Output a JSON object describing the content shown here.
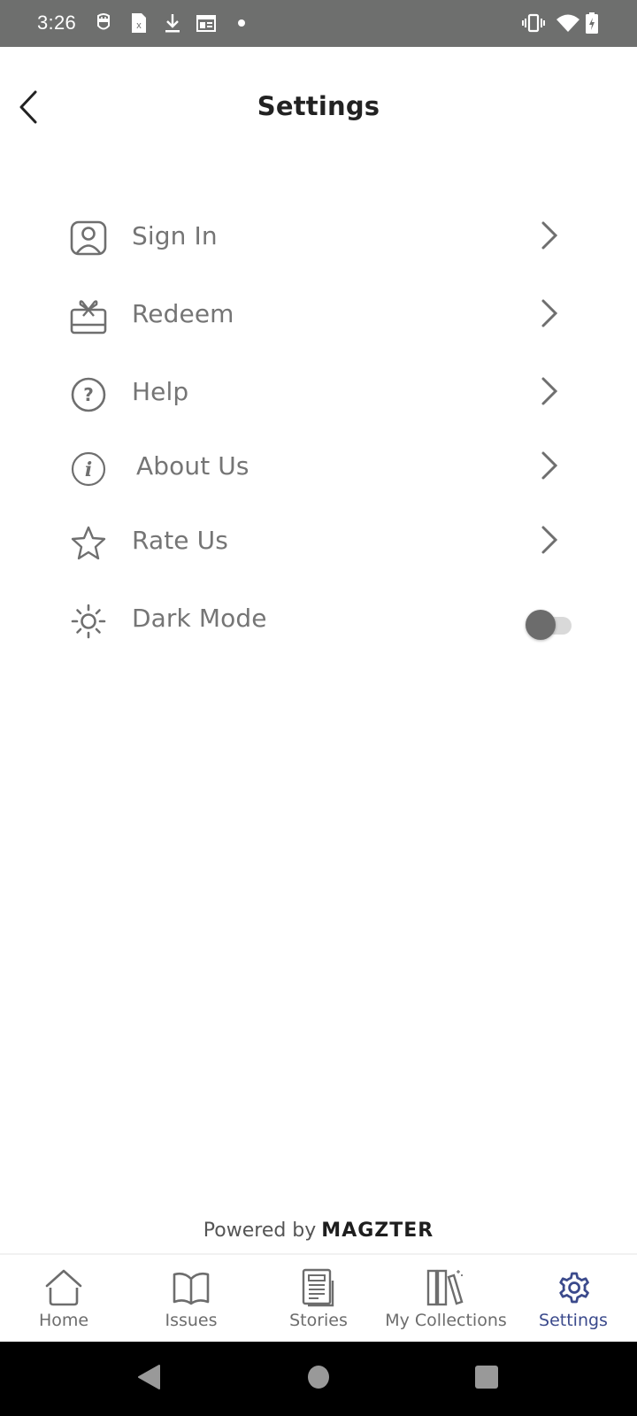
{
  "status_bar": {
    "time": "3:26",
    "left_icons": [
      "messaging-icon",
      "sim-card-icon",
      "download-icon",
      "calendar-icon",
      "notification-dot-icon"
    ],
    "right_icons": [
      "vibrate-icon",
      "wifi-icon",
      "battery-charging-icon"
    ]
  },
  "header": {
    "title": "Settings",
    "back_icon": "chevron-left-icon"
  },
  "menu": {
    "items": [
      {
        "label": "Sign In",
        "icon": "user-icon",
        "action": "chevron-right-icon"
      },
      {
        "label": "Redeem",
        "icon": "gift-icon",
        "action": "chevron-right-icon"
      },
      {
        "label": "Help",
        "icon": "help-circle-icon",
        "action": "chevron-right-icon"
      },
      {
        "label": "About Us",
        "icon": "info-icon",
        "action": "chevron-right-icon"
      },
      {
        "label": "Rate Us",
        "icon": "star-icon",
        "action": "chevron-right-icon"
      },
      {
        "label": "Dark Mode",
        "icon": "sun-icon",
        "action": "toggle",
        "toggle_on": false
      }
    ]
  },
  "footer": {
    "powered_by": "Powered by",
    "brand": "MAGZTER"
  },
  "bottom_nav": {
    "items": [
      {
        "label": "Home",
        "icon": "home-icon",
        "active": false
      },
      {
        "label": "Issues",
        "icon": "book-icon",
        "active": false
      },
      {
        "label": "Stories",
        "icon": "article-icon",
        "active": false
      },
      {
        "label": "My Collections",
        "icon": "collections-icon",
        "active": false
      },
      {
        "label": "Settings",
        "icon": "gear-icon",
        "active": true
      }
    ]
  },
  "colors": {
    "status_bar_bg": "#6e6f6e",
    "text_primary": "#222222",
    "menu_text": "#757575",
    "icon_gray": "#6f6f6f",
    "active_nav": "#3b4a8c",
    "toggle_thumb": "#6c6c6c",
    "toggle_track": "#d9d9d9",
    "system_nav_bg": "#000000"
  }
}
